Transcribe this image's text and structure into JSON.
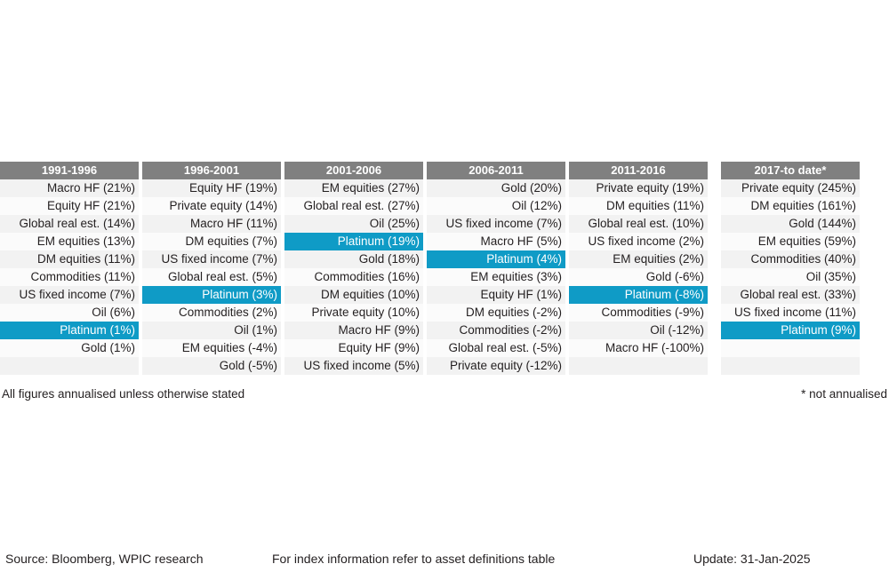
{
  "table": {
    "columns": [
      {
        "header": "1991-1996",
        "rows": [
          {
            "label": "Macro HF (21%)",
            "highlight": false
          },
          {
            "label": "Equity HF (21%)",
            "highlight": false
          },
          {
            "label": "Global real est. (14%)",
            "highlight": false
          },
          {
            "label": "EM equities (13%)",
            "highlight": false
          },
          {
            "label": "DM equities (11%)",
            "highlight": false
          },
          {
            "label": "Commodities (11%)",
            "highlight": false
          },
          {
            "label": "US fixed income (7%)",
            "highlight": false
          },
          {
            "label": "Oil (6%)",
            "highlight": false
          },
          {
            "label": "Platinum (1%)",
            "highlight": true
          },
          {
            "label": "Gold (1%)",
            "highlight": false
          },
          {
            "label": "",
            "highlight": false
          }
        ]
      },
      {
        "header": "1996-2001",
        "rows": [
          {
            "label": "Equity HF (19%)",
            "highlight": false
          },
          {
            "label": "Private equity (14%)",
            "highlight": false
          },
          {
            "label": "Macro HF (11%)",
            "highlight": false
          },
          {
            "label": "DM equities (7%)",
            "highlight": false
          },
          {
            "label": "US fixed income (7%)",
            "highlight": false
          },
          {
            "label": "Global real est. (5%)",
            "highlight": false
          },
          {
            "label": "Platinum (3%)",
            "highlight": true
          },
          {
            "label": "Commodities (2%)",
            "highlight": false
          },
          {
            "label": "Oil (1%)",
            "highlight": false
          },
          {
            "label": "EM equities (-4%)",
            "highlight": false
          },
          {
            "label": "Gold (-5%)",
            "highlight": false
          }
        ]
      },
      {
        "header": "2001-2006",
        "rows": [
          {
            "label": "EM equities (27%)",
            "highlight": false
          },
          {
            "label": "Global real est. (27%)",
            "highlight": false
          },
          {
            "label": "Oil (25%)",
            "highlight": false
          },
          {
            "label": "Platinum (19%)",
            "highlight": true
          },
          {
            "label": "Gold (18%)",
            "highlight": false
          },
          {
            "label": "Commodities (16%)",
            "highlight": false
          },
          {
            "label": "DM equities (10%)",
            "highlight": false
          },
          {
            "label": "Private equity (10%)",
            "highlight": false
          },
          {
            "label": "Macro HF (9%)",
            "highlight": false
          },
          {
            "label": "Equity HF (9%)",
            "highlight": false
          },
          {
            "label": "US fixed income (5%)",
            "highlight": false
          }
        ]
      },
      {
        "header": "2006-2011",
        "rows": [
          {
            "label": "Gold (20%)",
            "highlight": false
          },
          {
            "label": "Oil (12%)",
            "highlight": false
          },
          {
            "label": "US fixed income (7%)",
            "highlight": false
          },
          {
            "label": "Macro HF (5%)",
            "highlight": false
          },
          {
            "label": "Platinum (4%)",
            "highlight": true
          },
          {
            "label": "EM equities (3%)",
            "highlight": false
          },
          {
            "label": "Equity HF (1%)",
            "highlight": false
          },
          {
            "label": "DM equities (-2%)",
            "highlight": false
          },
          {
            "label": "Commodities (-2%)",
            "highlight": false
          },
          {
            "label": "Global real est. (-5%)",
            "highlight": false
          },
          {
            "label": "Private equity (-12%)",
            "highlight": false
          }
        ]
      },
      {
        "header": "2011-2016",
        "rows": [
          {
            "label": "Private equity (19%)",
            "highlight": false
          },
          {
            "label": "DM equities (11%)",
            "highlight": false
          },
          {
            "label": "Global real est. (10%)",
            "highlight": false
          },
          {
            "label": "US fixed income (2%)",
            "highlight": false
          },
          {
            "label": "EM equities (2%)",
            "highlight": false
          },
          {
            "label": "Gold (-6%)",
            "highlight": false
          },
          {
            "label": "Platinum (-8%)",
            "highlight": true
          },
          {
            "label": "Commodities (-9%)",
            "highlight": false
          },
          {
            "label": "Oil (-12%)",
            "highlight": false
          },
          {
            "label": "Macro HF (-100%)",
            "highlight": false
          },
          {
            "label": "",
            "highlight": false
          }
        ]
      },
      {
        "header": "2017-to date*",
        "rows": [
          {
            "label": "Private equity (245%)",
            "highlight": false
          },
          {
            "label": "DM equities (161%)",
            "highlight": false
          },
          {
            "label": "Gold (144%)",
            "highlight": false
          },
          {
            "label": "EM equities (59%)",
            "highlight": false
          },
          {
            "label": "Commodities (40%)",
            "highlight": false
          },
          {
            "label": "Oil (35%)",
            "highlight": false
          },
          {
            "label": "Global real est. (33%)",
            "highlight": false
          },
          {
            "label": "US fixed income (11%)",
            "highlight": false
          },
          {
            "label": "Platinum (9%)",
            "highlight": true
          },
          {
            "label": "",
            "highlight": false
          },
          {
            "label": "",
            "highlight": false
          }
        ]
      }
    ]
  },
  "notes": {
    "left": "All figures annualised unless otherwise stated",
    "right": "* not annualised"
  },
  "footer": {
    "source": "Source: Bloomberg, WPIC research",
    "index_info": "For index information refer to asset definitions table",
    "update": "Update: 31-Jan-2025"
  },
  "colors": {
    "header_gray": "#808080",
    "highlight_teal": "#0f9bc6",
    "row_odd": "#f2f2f2",
    "row_even": "#fbfbfb",
    "text": "#231f20"
  }
}
